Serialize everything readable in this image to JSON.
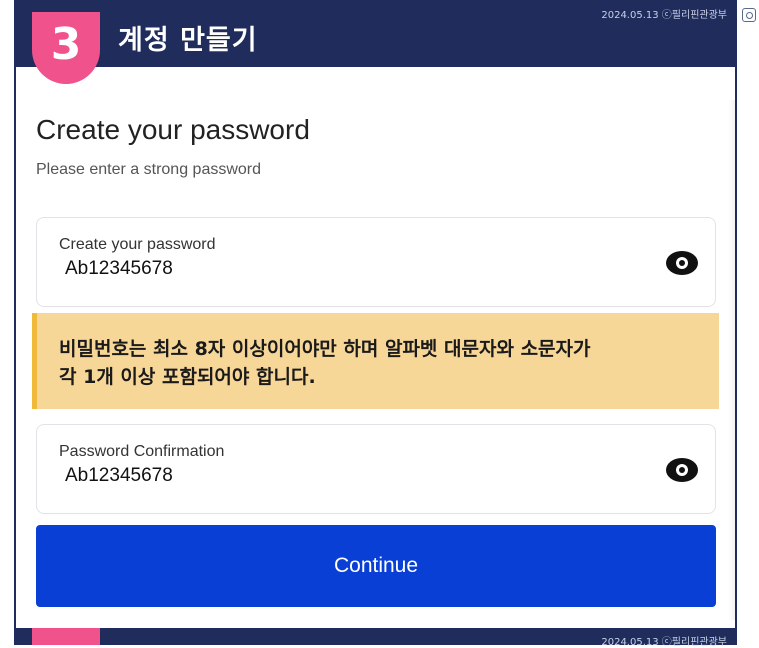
{
  "header": {
    "step_number": "3",
    "title": "계정 만들기",
    "date_stamp": "2024.05.13 ⓒ필리핀관광부"
  },
  "page": {
    "title": "Create your password",
    "subtitle": "Please enter a strong password"
  },
  "password_field": {
    "label": "Create your password",
    "value": "Ab12345678",
    "icon": "eye-icon"
  },
  "warning": {
    "line1": "비밀번호는 최소 8자 이상이어야만 하며 알파벳 대문자와 소문자가",
    "line2": "각 1개 이상 포함되어야 합니다."
  },
  "confirm_field": {
    "label": "Password Confirmation",
    "value": "Ab12345678",
    "icon": "eye-icon"
  },
  "continue_button": {
    "label": "Continue"
  },
  "footer": {
    "date_stamp": "2024.05.13 ⓒ필리핀관광부"
  },
  "colors": {
    "header_bg": "#1f2c5c",
    "step_badge": "#f0528c",
    "warning_bg": "#f7d798",
    "warning_border": "#f0b93a",
    "button_bg": "#0a3fd6"
  }
}
